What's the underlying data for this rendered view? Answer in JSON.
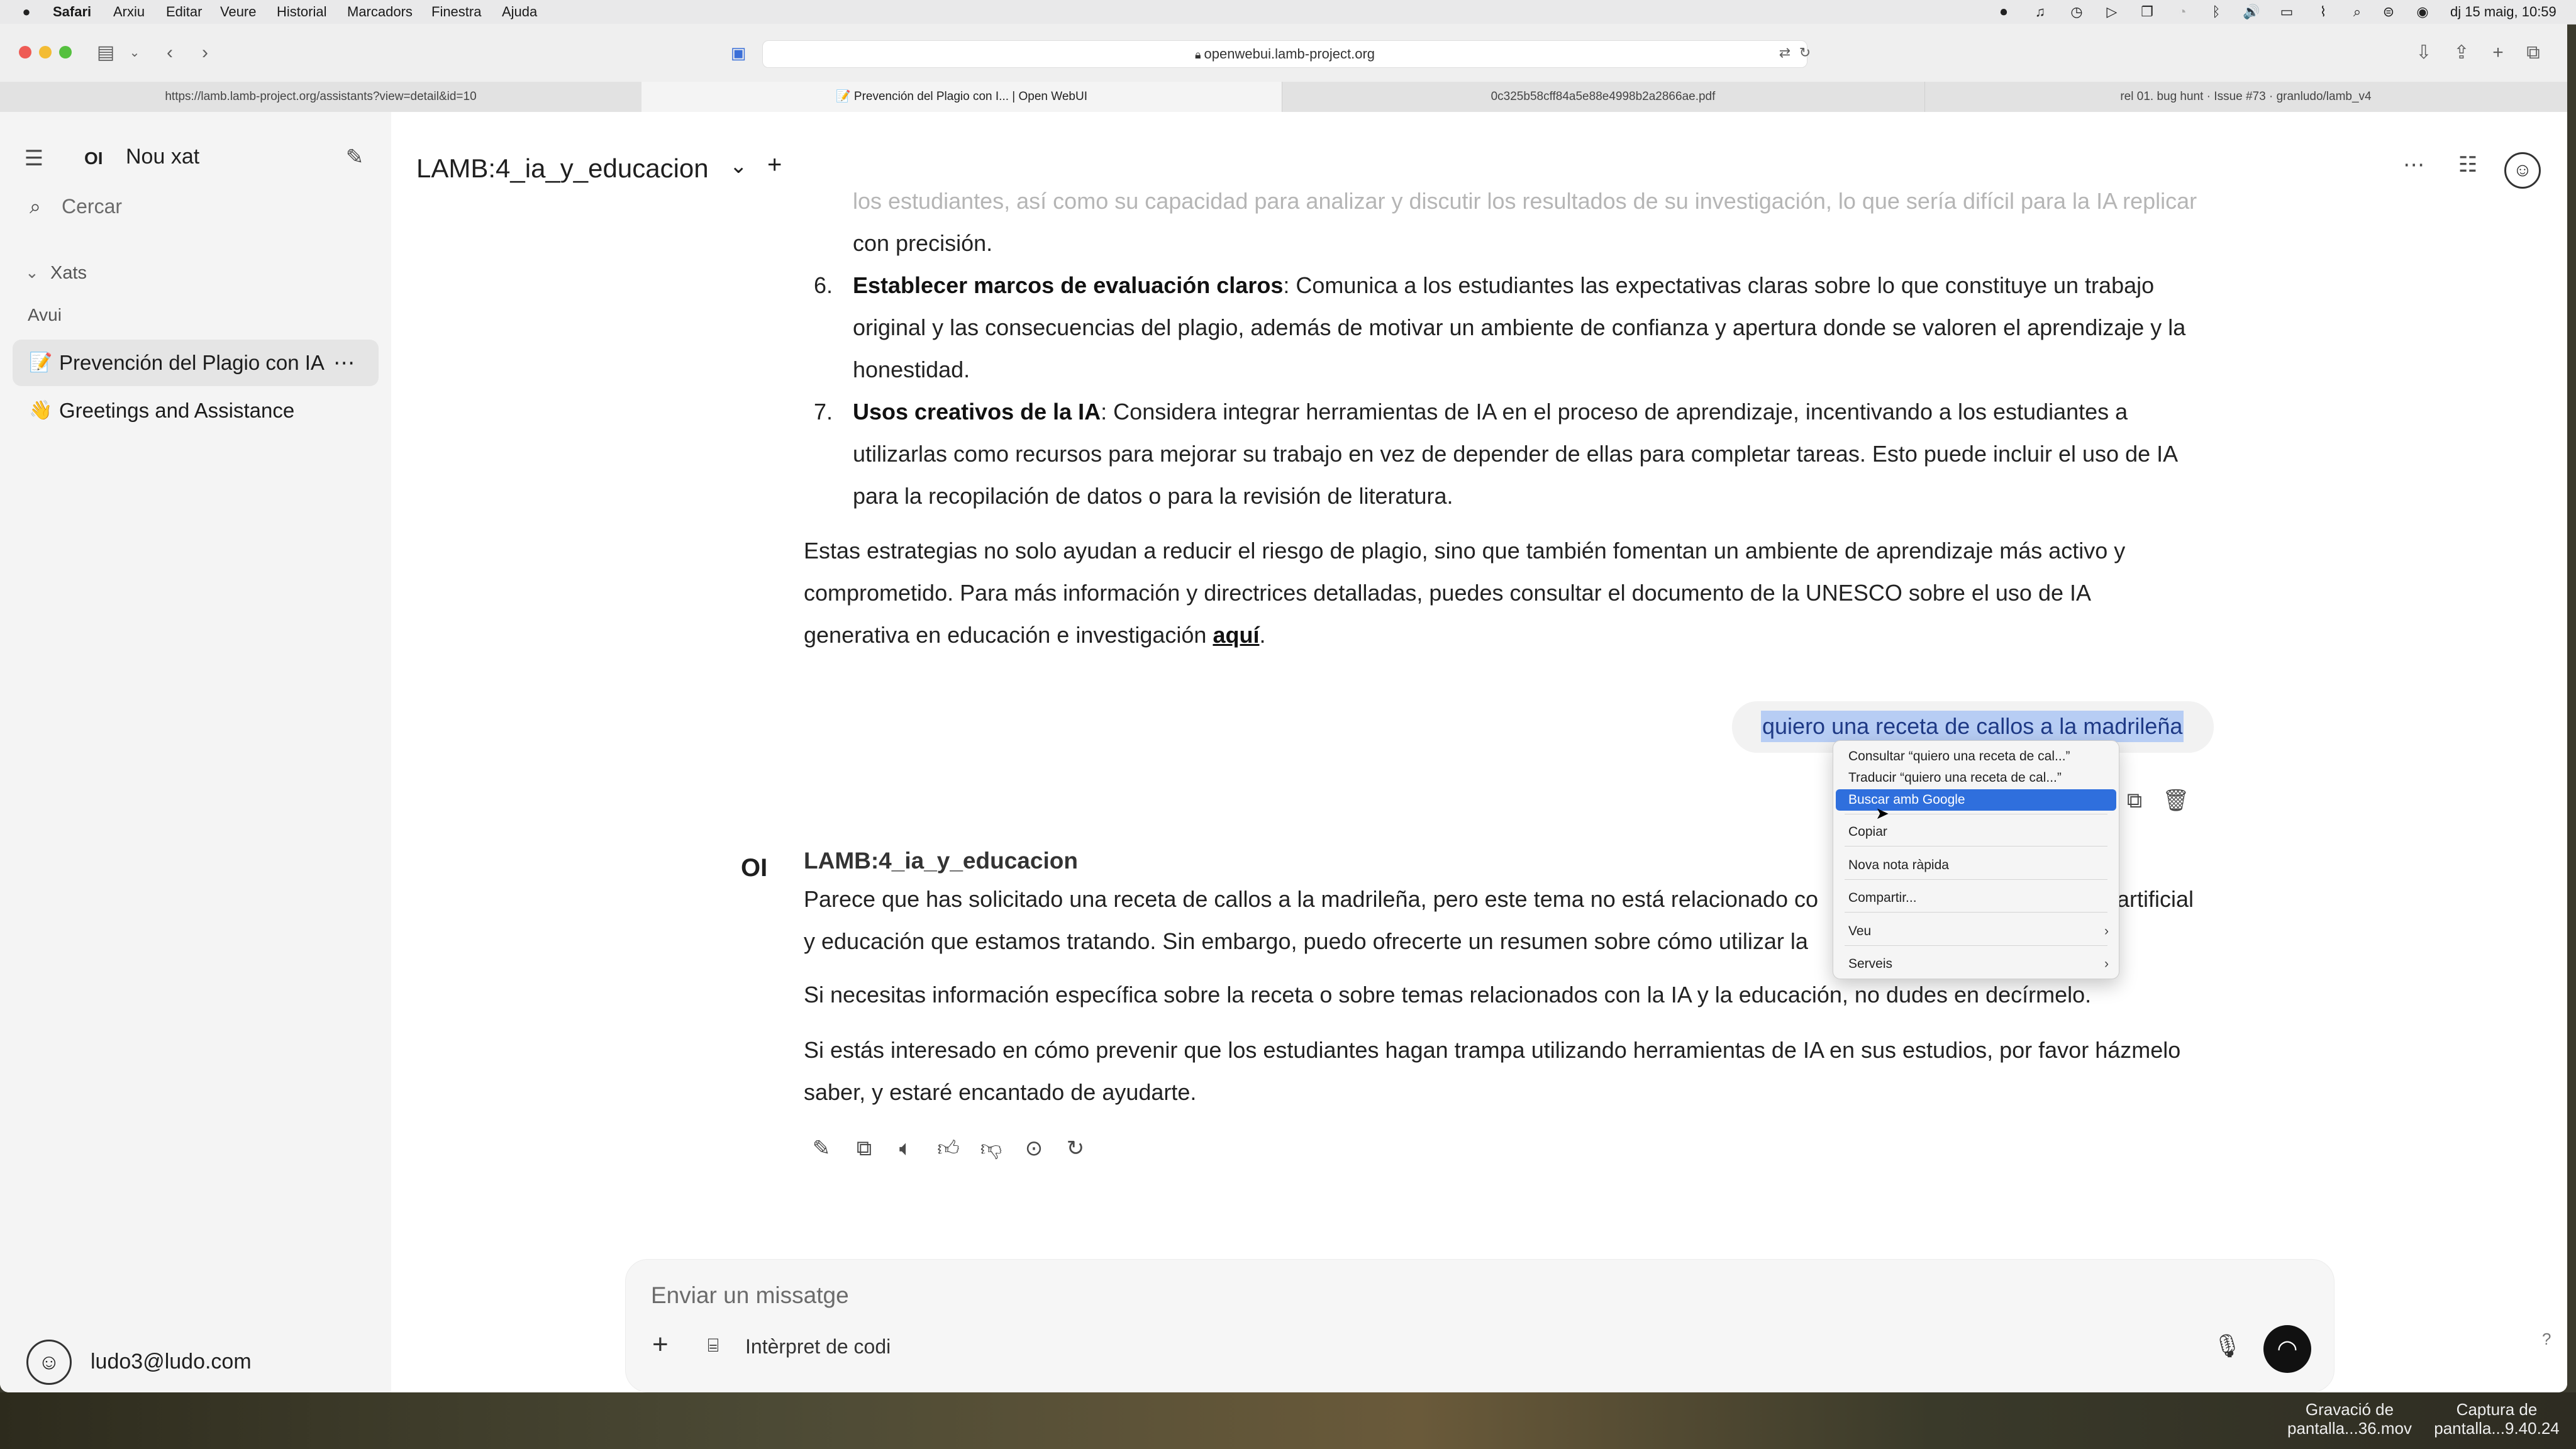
{
  "menubar": {
    "app": "Safari",
    "items": [
      "Arxiu",
      "Editar",
      "Veure",
      "Historial",
      "Marcadors",
      "Finestra",
      "Ajuda"
    ],
    "clock": "dj 15 maig, 10:59"
  },
  "browser": {
    "url": "openwebui.lamb-project.org",
    "tabs": [
      {
        "label": "https://lamb.lamb-project.org/assistants?view=detail&id=10"
      },
      {
        "label": "📝 Prevención del Plagio con I... | Open WebUI"
      },
      {
        "label": "0c325b58cff84a5e88e4998b2a2866ae.pdf"
      },
      {
        "label": "rel 01. bug hunt · Issue #73 · granludo/lamb_v4"
      }
    ]
  },
  "sidebar": {
    "logo": "OI",
    "new_chat": "Nou xat",
    "search_placeholder": "Cercar",
    "section": "Xats",
    "group": "Avui",
    "chats": [
      {
        "emoji": "📝",
        "title": "Prevención del Plagio con IA"
      },
      {
        "emoji": "👋",
        "title": "Greetings and Assistance"
      }
    ],
    "user": "ludo3@ludo.com"
  },
  "header": {
    "model": "LAMB:4_ia_y_educacion"
  },
  "conversation": {
    "faded_line": "los estudiantes, así como su capacidad para analizar y discutir los resultados de su investigación, lo que sería difícil para la IA replicar",
    "line_cont": "con precisión.",
    "item6": {
      "num": "6.",
      "bold": "Establecer marcos de evaluación claros",
      "l1": ": Comunica a los estudiantes las expectativas claras sobre lo que constituye un trabajo",
      "l2": "original y las consecuencias del plagio, además de motivar un ambiente de confianza y apertura donde se valoren el aprendizaje y la",
      "l3": "honestidad."
    },
    "item7": {
      "num": "7.",
      "bold": "Usos creativos de la IA",
      "l1": ": Considera integrar herramientas de IA en el proceso de aprendizaje, incentivando a los estudiantes a",
      "l2": "utilizarlas como recursos para mejorar su trabajo en vez de depender de ellas para completar tareas. Esto puede incluir el uso de IA",
      "l3": "para la recopilación de datos o para la revisión de literatura."
    },
    "para": {
      "l1": "Estas estrategias no solo ayudan a reducir el riesgo de plagio, sino que también fomentan un ambiente de aprendizaje más activo y",
      "l2": "comprometido. Para más información y directrices detalladas, puedes consultar el documento de la UNESCO sobre el uso de IA",
      "l3": "generativa en educación e investigación ",
      "link": "aquí",
      "end": "."
    },
    "user_message": "quiero una receta de callos a la madrileña",
    "reply": {
      "avatar": "OI",
      "name": "LAMB:4_ia_y_educacion",
      "p1a": "Parece que has solicitado una receta de callos a la madrileña, pero este tema no está relacionado co",
      "p1a_tail": "artificial",
      "p1b": "y educación que estamos tratando. Sin embargo, puedo ofrecerte un resumen sobre cómo utilizar la",
      "p2": "Si necesitas información específica sobre la receta o sobre temas relacionados con la IA y la educación, no dudes en decírmelo.",
      "p3a": "Si estás interesado en cómo prevenir que los estudiantes hagan trampa utilizando herramientas de IA en sus estudios, por favor házmelo",
      "p3b": "saber, y estaré encantado de ayudarte."
    }
  },
  "context_menu": {
    "items": [
      "Consultar “quiero una receta de cal...”",
      "Traducir “quiero una receta de cal...”",
      "Buscar amb Google",
      "Copiar",
      "Nova nota ràpida",
      "Compartir...",
      "Veu",
      "Serveis"
    ]
  },
  "composer": {
    "placeholder": "Enviar un missatge",
    "code_interpreter": "Intèrpret de codi"
  },
  "desktop": {
    "files": [
      "Gravació de pantalla...36.mov",
      "Captura de pantalla...9.40.24"
    ]
  }
}
